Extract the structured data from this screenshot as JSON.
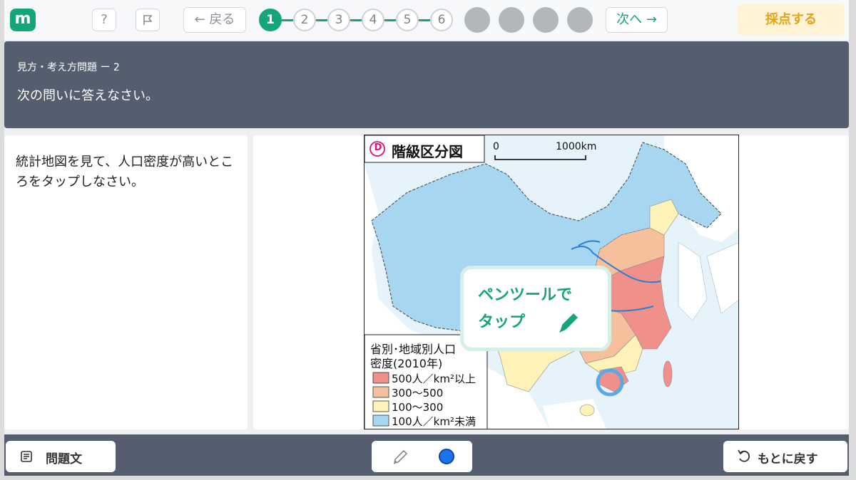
{
  "topbar": {
    "logo": "m",
    "help_label": "?",
    "back_label": "← 戻る",
    "steps": [
      "1",
      "2",
      "3",
      "4",
      "5",
      "6"
    ],
    "next_label": "次へ →",
    "grade_label": "採点する"
  },
  "header": {
    "question_number": "見方・考え方問題 ー 2",
    "instruction": "次の問いに答えなさい。"
  },
  "question": {
    "text": "統計地図を見て、人口密度が高いところをタップしなさい。"
  },
  "map": {
    "badge": "D",
    "title": "階級区分図",
    "scale_zero": "0",
    "scale_label": "1000km",
    "legend_title_1": "省別･地域別人口",
    "legend_title_2": "密度(2010年)",
    "legend": [
      {
        "label": "500人／km²以上",
        "color": "#f0908a"
      },
      {
        "label": "300〜500",
        "color": "#f6c09c"
      },
      {
        "label": "100〜300",
        "color": "#fdf2b8"
      },
      {
        "label": "100人／km²未満",
        "color": "#a6d6f0"
      }
    ],
    "tooltip_line1": "ペンツールで",
    "tooltip_line2": "タップ"
  },
  "bottom": {
    "problem_text_label": "問題文",
    "return_label": "もとに戻す",
    "pen_color": "#1a73e8"
  }
}
